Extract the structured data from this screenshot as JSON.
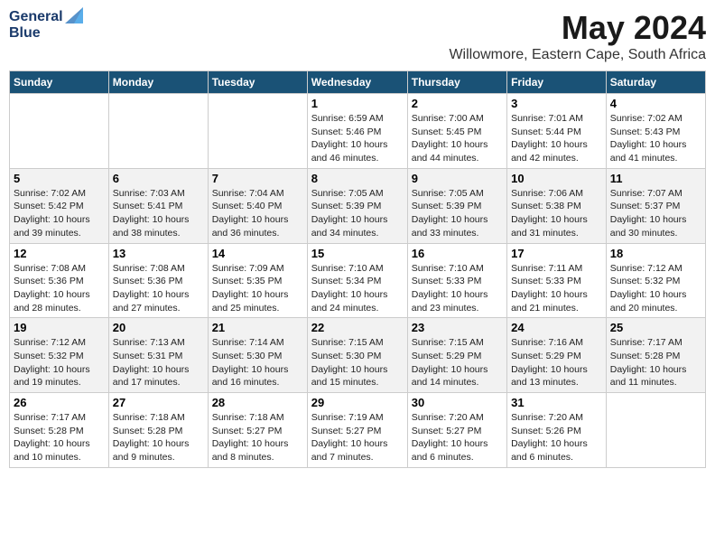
{
  "header": {
    "logo_line1": "General",
    "logo_line2": "Blue",
    "month": "May 2024",
    "location": "Willowmore, Eastern Cape, South Africa"
  },
  "weekdays": [
    "Sunday",
    "Monday",
    "Tuesday",
    "Wednesday",
    "Thursday",
    "Friday",
    "Saturday"
  ],
  "weeks": [
    [
      {
        "day": "",
        "info": ""
      },
      {
        "day": "",
        "info": ""
      },
      {
        "day": "",
        "info": ""
      },
      {
        "day": "1",
        "info": "Sunrise: 6:59 AM\nSunset: 5:46 PM\nDaylight: 10 hours\nand 46 minutes."
      },
      {
        "day": "2",
        "info": "Sunrise: 7:00 AM\nSunset: 5:45 PM\nDaylight: 10 hours\nand 44 minutes."
      },
      {
        "day": "3",
        "info": "Sunrise: 7:01 AM\nSunset: 5:44 PM\nDaylight: 10 hours\nand 42 minutes."
      },
      {
        "day": "4",
        "info": "Sunrise: 7:02 AM\nSunset: 5:43 PM\nDaylight: 10 hours\nand 41 minutes."
      }
    ],
    [
      {
        "day": "5",
        "info": "Sunrise: 7:02 AM\nSunset: 5:42 PM\nDaylight: 10 hours\nand 39 minutes."
      },
      {
        "day": "6",
        "info": "Sunrise: 7:03 AM\nSunset: 5:41 PM\nDaylight: 10 hours\nand 38 minutes."
      },
      {
        "day": "7",
        "info": "Sunrise: 7:04 AM\nSunset: 5:40 PM\nDaylight: 10 hours\nand 36 minutes."
      },
      {
        "day": "8",
        "info": "Sunrise: 7:05 AM\nSunset: 5:39 PM\nDaylight: 10 hours\nand 34 minutes."
      },
      {
        "day": "9",
        "info": "Sunrise: 7:05 AM\nSunset: 5:39 PM\nDaylight: 10 hours\nand 33 minutes."
      },
      {
        "day": "10",
        "info": "Sunrise: 7:06 AM\nSunset: 5:38 PM\nDaylight: 10 hours\nand 31 minutes."
      },
      {
        "day": "11",
        "info": "Sunrise: 7:07 AM\nSunset: 5:37 PM\nDaylight: 10 hours\nand 30 minutes."
      }
    ],
    [
      {
        "day": "12",
        "info": "Sunrise: 7:08 AM\nSunset: 5:36 PM\nDaylight: 10 hours\nand 28 minutes."
      },
      {
        "day": "13",
        "info": "Sunrise: 7:08 AM\nSunset: 5:36 PM\nDaylight: 10 hours\nand 27 minutes."
      },
      {
        "day": "14",
        "info": "Sunrise: 7:09 AM\nSunset: 5:35 PM\nDaylight: 10 hours\nand 25 minutes."
      },
      {
        "day": "15",
        "info": "Sunrise: 7:10 AM\nSunset: 5:34 PM\nDaylight: 10 hours\nand 24 minutes."
      },
      {
        "day": "16",
        "info": "Sunrise: 7:10 AM\nSunset: 5:33 PM\nDaylight: 10 hours\nand 23 minutes."
      },
      {
        "day": "17",
        "info": "Sunrise: 7:11 AM\nSunset: 5:33 PM\nDaylight: 10 hours\nand 21 minutes."
      },
      {
        "day": "18",
        "info": "Sunrise: 7:12 AM\nSunset: 5:32 PM\nDaylight: 10 hours\nand 20 minutes."
      }
    ],
    [
      {
        "day": "19",
        "info": "Sunrise: 7:12 AM\nSunset: 5:32 PM\nDaylight: 10 hours\nand 19 minutes."
      },
      {
        "day": "20",
        "info": "Sunrise: 7:13 AM\nSunset: 5:31 PM\nDaylight: 10 hours\nand 17 minutes."
      },
      {
        "day": "21",
        "info": "Sunrise: 7:14 AM\nSunset: 5:30 PM\nDaylight: 10 hours\nand 16 minutes."
      },
      {
        "day": "22",
        "info": "Sunrise: 7:15 AM\nSunset: 5:30 PM\nDaylight: 10 hours\nand 15 minutes."
      },
      {
        "day": "23",
        "info": "Sunrise: 7:15 AM\nSunset: 5:29 PM\nDaylight: 10 hours\nand 14 minutes."
      },
      {
        "day": "24",
        "info": "Sunrise: 7:16 AM\nSunset: 5:29 PM\nDaylight: 10 hours\nand 13 minutes."
      },
      {
        "day": "25",
        "info": "Sunrise: 7:17 AM\nSunset: 5:28 PM\nDaylight: 10 hours\nand 11 minutes."
      }
    ],
    [
      {
        "day": "26",
        "info": "Sunrise: 7:17 AM\nSunset: 5:28 PM\nDaylight: 10 hours\nand 10 minutes."
      },
      {
        "day": "27",
        "info": "Sunrise: 7:18 AM\nSunset: 5:28 PM\nDaylight: 10 hours\nand 9 minutes."
      },
      {
        "day": "28",
        "info": "Sunrise: 7:18 AM\nSunset: 5:27 PM\nDaylight: 10 hours\nand 8 minutes."
      },
      {
        "day": "29",
        "info": "Sunrise: 7:19 AM\nSunset: 5:27 PM\nDaylight: 10 hours\nand 7 minutes."
      },
      {
        "day": "30",
        "info": "Sunrise: 7:20 AM\nSunset: 5:27 PM\nDaylight: 10 hours\nand 6 minutes."
      },
      {
        "day": "31",
        "info": "Sunrise: 7:20 AM\nSunset: 5:26 PM\nDaylight: 10 hours\nand 6 minutes."
      },
      {
        "day": "",
        "info": ""
      }
    ]
  ]
}
